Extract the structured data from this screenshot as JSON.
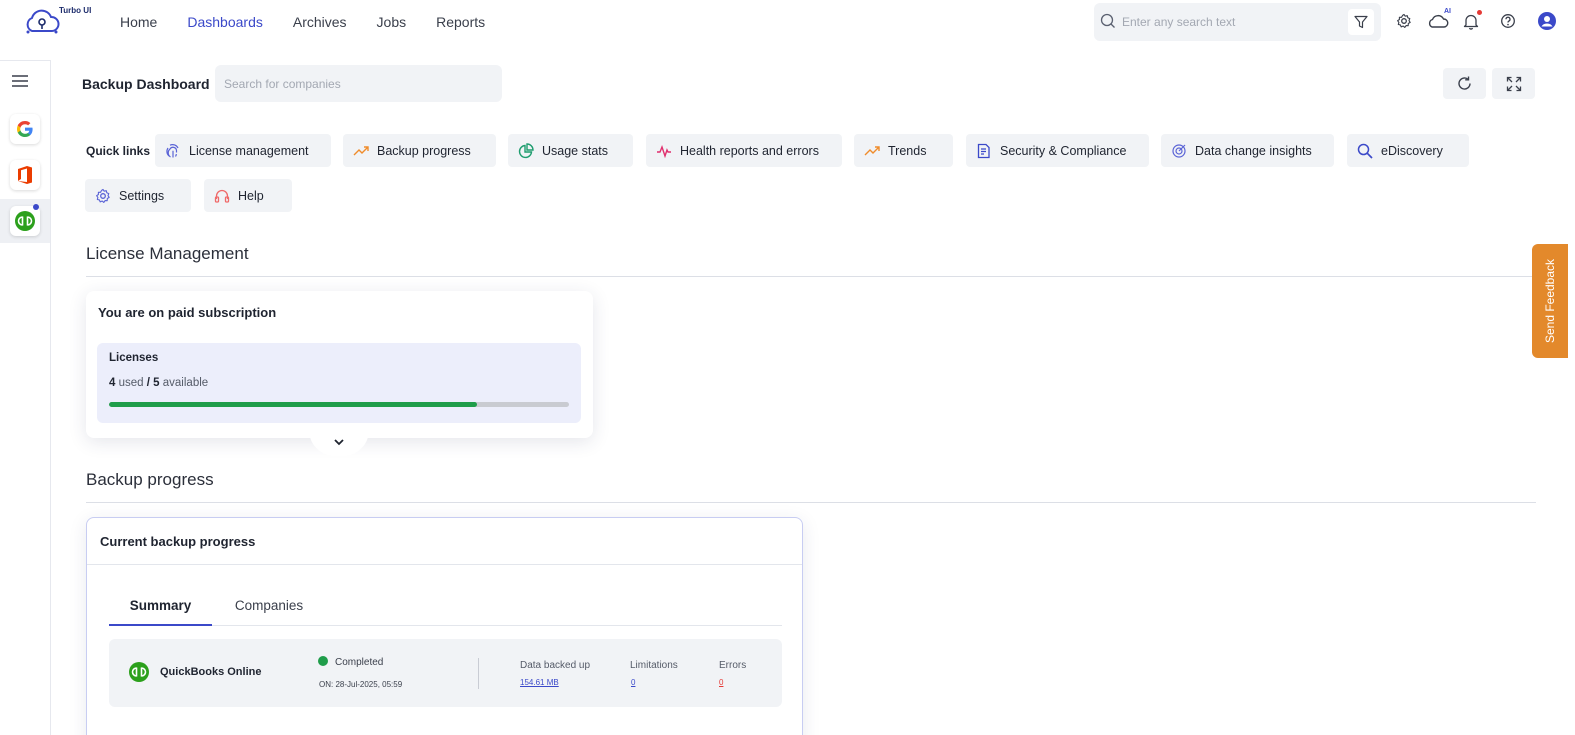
{
  "app": {
    "logo_text": "Turbo UI"
  },
  "nav": {
    "items": [
      {
        "label": "Home",
        "active": false
      },
      {
        "label": "Dashboards",
        "active": true
      },
      {
        "label": "Archives",
        "active": false
      },
      {
        "label": "Jobs",
        "active": false
      },
      {
        "label": "Reports",
        "active": false
      }
    ]
  },
  "top_search": {
    "placeholder": "Enter any search text",
    "value": ""
  },
  "top_icons": {
    "filter": "filter-icon",
    "settings": "gear-icon",
    "ai": "cloud-ai-icon",
    "ai_label": "AI",
    "notifications": "bell-icon",
    "help": "help-icon",
    "profile": "user-avatar-icon"
  },
  "sidebar": {
    "menu_icon": "hamburger-icon",
    "apps": [
      {
        "name": "google-workspace",
        "icon": "google-icon"
      },
      {
        "name": "microsoft-office",
        "icon": "office-icon"
      },
      {
        "name": "quickbooks",
        "icon": "quickbooks-icon",
        "active": true
      }
    ]
  },
  "header": {
    "title": "Backup Dashboard",
    "company_search_placeholder": "Search for companies",
    "refresh_icon": "refresh-icon",
    "fullscreen_icon": "expand-icon"
  },
  "quick_links": {
    "label": "Quick links",
    "items": [
      {
        "label": "License management",
        "icon": "fingerprint-icon"
      },
      {
        "label": "Backup progress",
        "icon": "trend-up-icon"
      },
      {
        "label": "Usage stats",
        "icon": "pie-chart-icon"
      },
      {
        "label": "Health reports and errors",
        "icon": "pulse-icon"
      },
      {
        "label": "Trends",
        "icon": "trend-up-icon"
      },
      {
        "label": "Security & Compliance",
        "icon": "shield-document-icon"
      },
      {
        "label": "Data change insights",
        "icon": "radar-icon"
      },
      {
        "label": "eDiscovery",
        "icon": "magnifier-icon"
      },
      {
        "label": "Settings",
        "icon": "gear-icon"
      },
      {
        "label": "Help",
        "icon": "headset-icon"
      }
    ]
  },
  "license_section": {
    "title": "License Management",
    "card_title": "You are on paid subscription",
    "licenses_label": "Licenses",
    "used": "4",
    "used_label": "used",
    "separator": "/",
    "available": "5",
    "available_label": "available",
    "usage_fraction": 0.8,
    "colors": {
      "fill": "#1f9d4a",
      "track": "#c9cbd1"
    }
  },
  "backup_section": {
    "title": "Backup progress",
    "card_title": "Current backup progress",
    "tabs": [
      {
        "label": "Summary",
        "active": true
      },
      {
        "label": "Companies",
        "active": false
      }
    ],
    "row": {
      "app_name": "QuickBooks Online",
      "status": "Completed",
      "status_color": "#1f9d4a",
      "date": "ON: 28-Jul-2025, 05:59",
      "metrics": [
        {
          "label": "Data backed up",
          "value": "154.61 MB",
          "color": "#3b49c9"
        },
        {
          "label": "Limitations",
          "value": "0",
          "color": "#3b49c9"
        },
        {
          "label": "Errors",
          "value": "0",
          "color": "#e53935"
        }
      ]
    }
  },
  "feedback": {
    "label": "Send Feedback",
    "color": "#e3892b"
  }
}
